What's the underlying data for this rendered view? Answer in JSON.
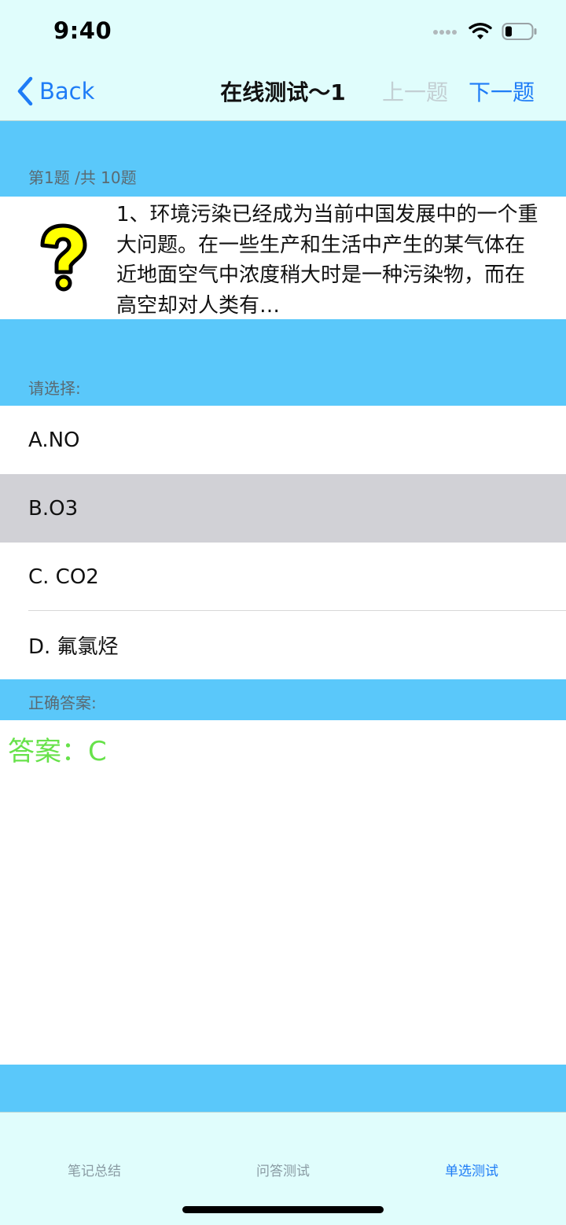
{
  "status_bar": {
    "time": "9:40"
  },
  "nav": {
    "back_label": "Back",
    "title": "在线测试～1",
    "prev_label": "上一题",
    "next_label": "下一题"
  },
  "question": {
    "counter": "第1题 /共 10题",
    "text": "1、环境污染已经成为当前中国发展中的一个重大问题。在一些生产和生活中产生的某气体在近地面空气中浓度稍大时是一种污染物，而在高空却对人类有…"
  },
  "choices": {
    "header": "请选择:",
    "options": [
      {
        "label": "A.NO",
        "selected": false
      },
      {
        "label": "B.O3",
        "selected": true
      },
      {
        "label": "C. CO2",
        "selected": false
      },
      {
        "label": "D. 氟氯烃",
        "selected": false
      }
    ]
  },
  "answer": {
    "header": "正确答案:",
    "text": "答案：C"
  },
  "tabs": [
    {
      "label": "笔记总结",
      "active": false
    },
    {
      "label": "问答测试",
      "active": false
    },
    {
      "label": "单选测试",
      "active": true
    }
  ],
  "colors": {
    "accent": "#1e7cf6",
    "header_band": "#5ac8fa",
    "bar_background": "#e0fdfc",
    "answer_green": "#67e24a",
    "selected_row": "#d1d1d6"
  },
  "icons": {
    "question": "question-mark-icon",
    "back": "chevron-left-icon",
    "signal": "cellular-signal-icon",
    "wifi": "wifi-icon",
    "battery": "battery-icon"
  }
}
